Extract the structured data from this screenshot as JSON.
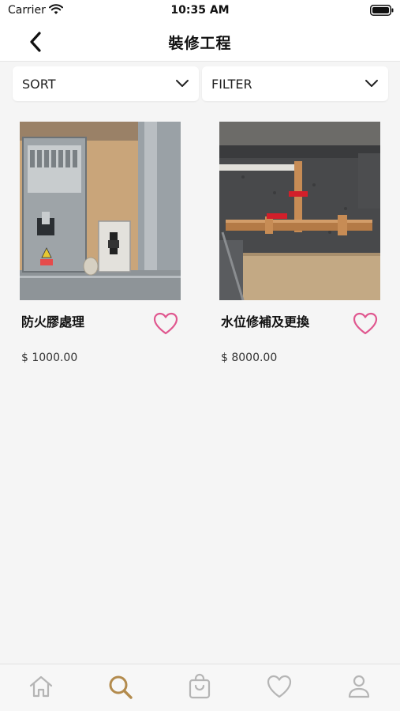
{
  "status_bar": {
    "carrier": "Carrier",
    "time": "10:35 AM"
  },
  "header": {
    "title": "裝修工程",
    "back_icon": "chevron-left-icon"
  },
  "controls": {
    "sort_label": "SORT",
    "filter_label": "FILTER"
  },
  "products": [
    {
      "name": "防火膠處理",
      "price": "$ 1000.00",
      "favorite": false,
      "image": "electrical-panel-photo"
    },
    {
      "name": "水位修補及更換",
      "price": "$ 8000.00",
      "favorite": false,
      "image": "water-pipe-valve-photo"
    }
  ],
  "tab_bar": {
    "items": [
      "home-icon",
      "search-icon",
      "shopping-bag-icon",
      "heart-icon",
      "profile-icon"
    ],
    "active": "search-icon"
  },
  "colors": {
    "accent_active": "#b38b4d",
    "inactive_icon": "#b5b5b5",
    "heart": "#e0578f"
  }
}
